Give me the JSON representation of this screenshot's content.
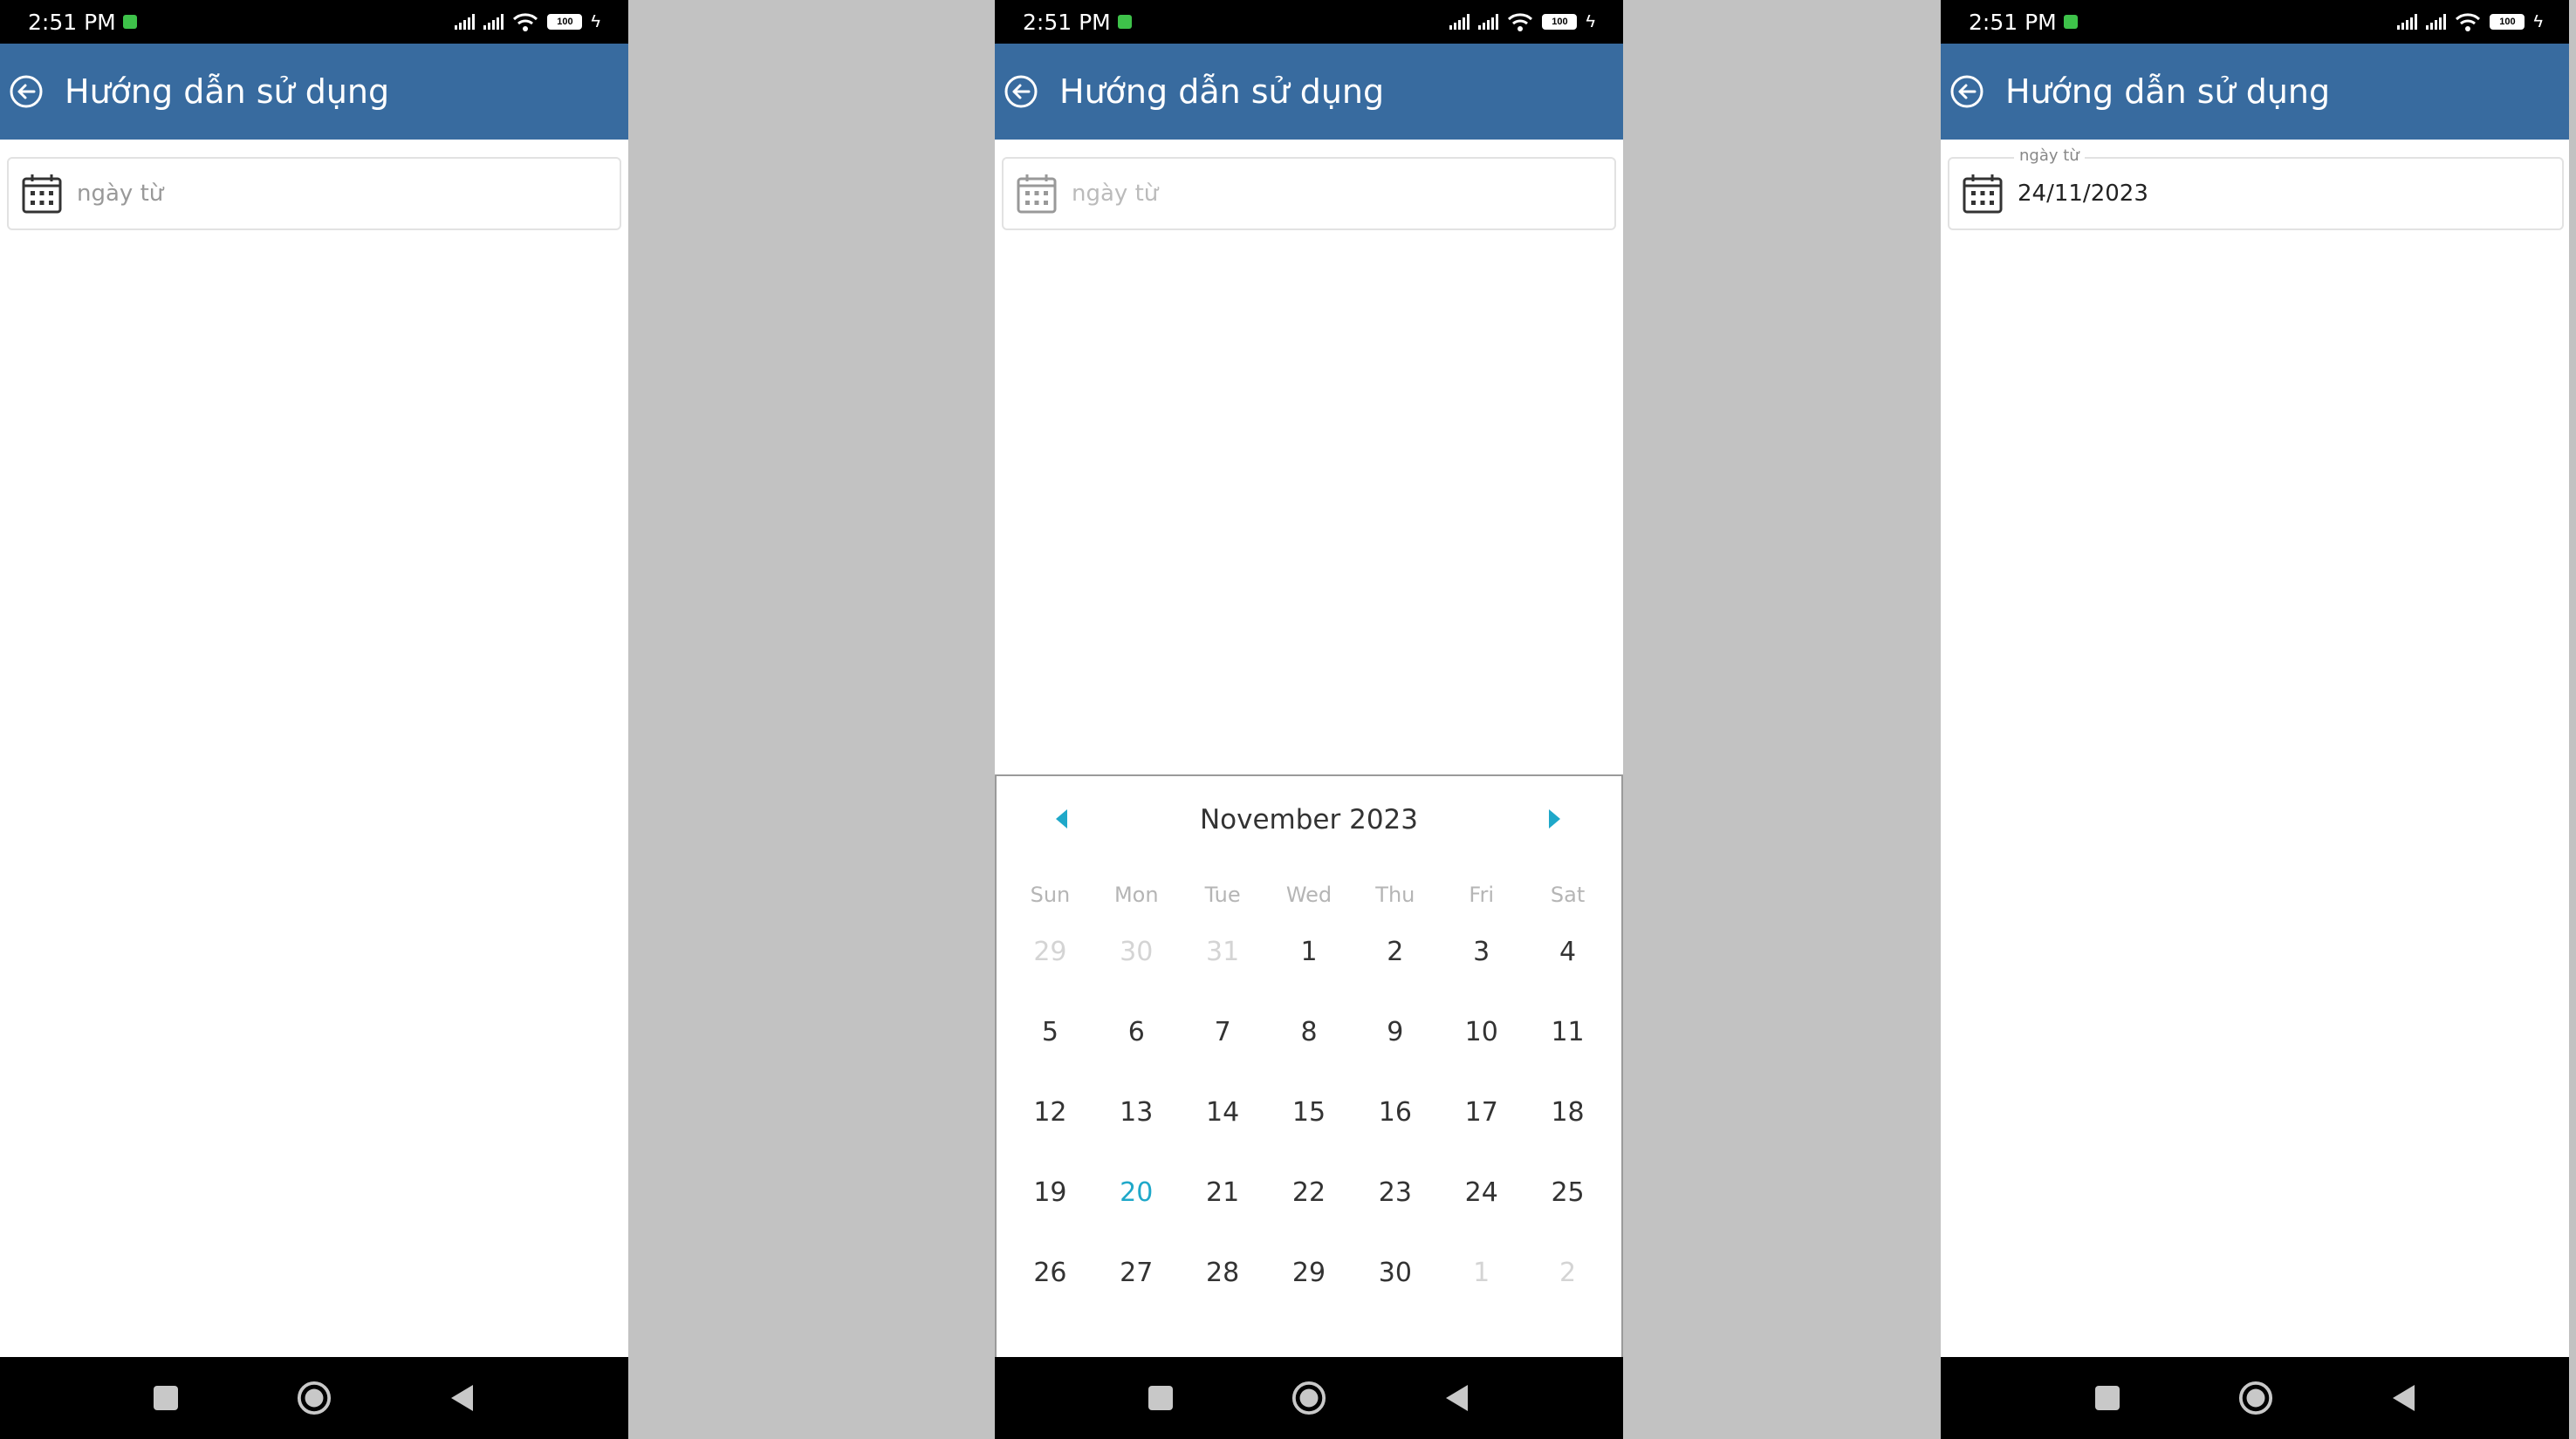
{
  "status": {
    "time": "2:51 PM",
    "battery": "100"
  },
  "appbar": {
    "title": "Hướng dẫn sử dụng"
  },
  "date_field": {
    "placeholder": "ngày từ",
    "label": "ngày từ",
    "value": "24/11/2023"
  },
  "picker": {
    "title": "November 2023",
    "weekdays": [
      "Sun",
      "Mon",
      "Tue",
      "Wed",
      "Thu",
      "Fri",
      "Sat"
    ],
    "days": [
      {
        "n": "29",
        "other": true
      },
      {
        "n": "30",
        "other": true
      },
      {
        "n": "31",
        "other": true
      },
      {
        "n": "1"
      },
      {
        "n": "2"
      },
      {
        "n": "3"
      },
      {
        "n": "4"
      },
      {
        "n": "5"
      },
      {
        "n": "6"
      },
      {
        "n": "7"
      },
      {
        "n": "8"
      },
      {
        "n": "9"
      },
      {
        "n": "10"
      },
      {
        "n": "11"
      },
      {
        "n": "12"
      },
      {
        "n": "13"
      },
      {
        "n": "14"
      },
      {
        "n": "15"
      },
      {
        "n": "16"
      },
      {
        "n": "17"
      },
      {
        "n": "18"
      },
      {
        "n": "19"
      },
      {
        "n": "20",
        "today": true
      },
      {
        "n": "21"
      },
      {
        "n": "22"
      },
      {
        "n": "23"
      },
      {
        "n": "24"
      },
      {
        "n": "25"
      },
      {
        "n": "26"
      },
      {
        "n": "27"
      },
      {
        "n": "28"
      },
      {
        "n": "29"
      },
      {
        "n": "30"
      },
      {
        "n": "1",
        "other": true
      },
      {
        "n": "2",
        "other": true
      }
    ]
  },
  "colors": {
    "appbar": "#386b9f",
    "accent": "#1fa8c9"
  }
}
